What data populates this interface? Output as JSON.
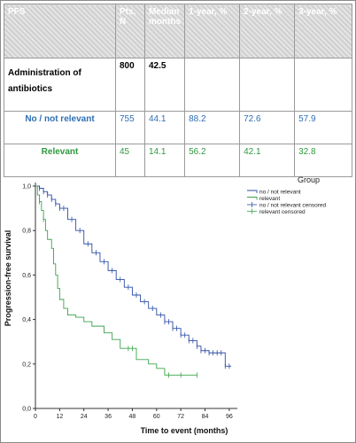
{
  "table": {
    "headers": [
      "PFS",
      "Pts, N",
      "Median months",
      "1-year, %",
      "2-year, %",
      "3-year, %"
    ],
    "rows": [
      {
        "label": "Administration of antibiotics",
        "n": "800",
        "median": "42.5",
        "y1": "",
        "y2": "",
        "y3": ""
      },
      {
        "label": "No / not relevant",
        "n": "755",
        "median": "44.1",
        "y1": "88.2",
        "y2": "72.6",
        "y3": "57.9"
      },
      {
        "label": "Relevant",
        "n": "45",
        "median": "14.1",
        "y1": "56.2",
        "y2": "42.1",
        "y3": "32.8"
      }
    ]
  },
  "chart_data": {
    "type": "line",
    "xlabel": "Time to event (months)",
    "ylabel": "Progression-free survival",
    "xlim": [
      0,
      100
    ],
    "ylim": [
      0,
      1.0
    ],
    "x_ticks": [
      0,
      12,
      24,
      36,
      48,
      60,
      72,
      84,
      96
    ],
    "y_ticks": [
      "0,0",
      "0,2",
      "0,4",
      "0,6",
      "0,8",
      "1,0"
    ],
    "legend_title": "Group",
    "legend": [
      {
        "label": "no / not relevant",
        "color": "#2f4fa8",
        "kind": "line"
      },
      {
        "label": "relevant",
        "color": "#3aa34a",
        "kind": "line"
      },
      {
        "label": "no / not relevant censored",
        "color": "#2f4fa8",
        "kind": "censor"
      },
      {
        "label": "relevant censored",
        "color": "#3aa34a",
        "kind": "censor"
      }
    ],
    "series": [
      {
        "name": "no / not relevant",
        "color": "#2f4fa8",
        "points": [
          [
            0,
            1.0
          ],
          [
            2,
            0.99
          ],
          [
            4,
            0.975
          ],
          [
            6,
            0.96
          ],
          [
            8,
            0.94
          ],
          [
            10,
            0.92
          ],
          [
            12,
            0.9
          ],
          [
            16,
            0.85
          ],
          [
            20,
            0.8
          ],
          [
            24,
            0.74
          ],
          [
            28,
            0.7
          ],
          [
            32,
            0.66
          ],
          [
            36,
            0.62
          ],
          [
            40,
            0.58
          ],
          [
            44,
            0.545
          ],
          [
            48,
            0.51
          ],
          [
            52,
            0.48
          ],
          [
            56,
            0.45
          ],
          [
            60,
            0.42
          ],
          [
            64,
            0.39
          ],
          [
            68,
            0.36
          ],
          [
            72,
            0.33
          ],
          [
            76,
            0.305
          ],
          [
            80,
            0.28
          ],
          [
            82,
            0.26
          ],
          [
            86,
            0.25
          ],
          [
            90,
            0.25
          ],
          [
            94,
            0.24
          ],
          [
            94,
            0.19
          ],
          [
            97,
            0.19
          ]
        ],
        "censored_x": [
          2,
          4,
          6,
          8,
          10,
          12,
          14,
          18,
          22,
          26,
          30,
          34,
          38,
          42,
          46,
          50,
          54,
          58,
          62,
          64,
          66,
          68,
          70,
          72,
          74,
          76,
          78,
          80,
          82,
          84,
          86,
          88,
          90,
          92,
          94,
          96
        ]
      },
      {
        "name": "relevant",
        "color": "#3aa34a",
        "points": [
          [
            0,
            1.0
          ],
          [
            1,
            0.96
          ],
          [
            2,
            0.93
          ],
          [
            3,
            0.89
          ],
          [
            4,
            0.85
          ],
          [
            5,
            0.8
          ],
          [
            6,
            0.76
          ],
          [
            8,
            0.72
          ],
          [
            9,
            0.65
          ],
          [
            10,
            0.6
          ],
          [
            11,
            0.54
          ],
          [
            12,
            0.49
          ],
          [
            14,
            0.45
          ],
          [
            16,
            0.42
          ],
          [
            20,
            0.41
          ],
          [
            24,
            0.39
          ],
          [
            28,
            0.37
          ],
          [
            34,
            0.34
          ],
          [
            38,
            0.31
          ],
          [
            42,
            0.27
          ],
          [
            50,
            0.22
          ],
          [
            56,
            0.2
          ],
          [
            60,
            0.18
          ],
          [
            64,
            0.15
          ],
          [
            72,
            0.15
          ],
          [
            80,
            0.15
          ]
        ],
        "censored_x": [
          2,
          4,
          46,
          48,
          66,
          72,
          80
        ]
      }
    ]
  }
}
